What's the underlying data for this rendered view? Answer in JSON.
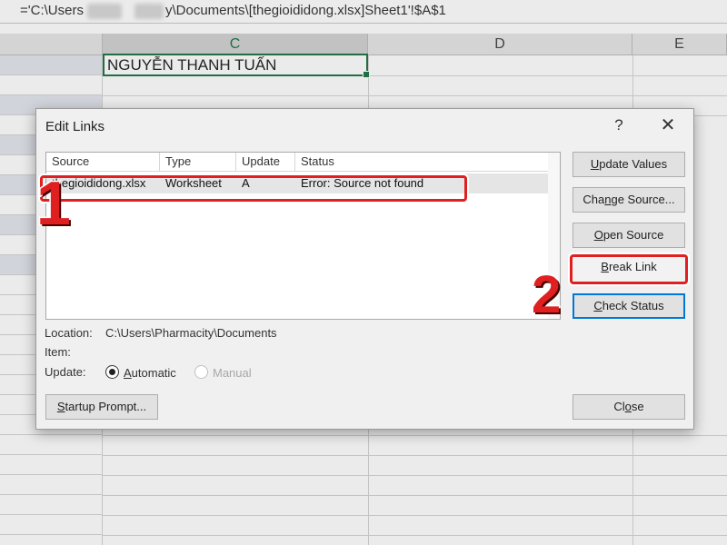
{
  "formula_bar": {
    "text_before": "='C:\\Users",
    "text_after": "y\\Documents\\[thegioididong.xlsx]Sheet1'!$A$1"
  },
  "grid": {
    "columns": [
      "C",
      "D",
      "E"
    ],
    "selected_column": "C",
    "cell_c1": "NGUYỄN THANH TUẤN"
  },
  "dialog": {
    "title": "Edit Links",
    "help": "?",
    "close": "✕",
    "table": {
      "headers": [
        "Source",
        "Type",
        "Update",
        "Status"
      ],
      "rows": [
        {
          "source": "thegioididong.xlsx",
          "type": "Worksheet",
          "update": "A",
          "status": "Error: Source not found"
        }
      ]
    },
    "buttons": {
      "update_values": {
        "u": "U",
        "rest": "pdate Values"
      },
      "change_source": {
        "pre": "Cha",
        "u": "n",
        "rest": "ge Source..."
      },
      "open_source": {
        "u": "O",
        "rest": "pen Source"
      },
      "break_link": {
        "u": "B",
        "rest": "reak Link"
      },
      "check_status": {
        "u": "C",
        "rest": "heck Status"
      },
      "startup_prompt": {
        "u": "S",
        "rest": "tartup Prompt..."
      },
      "close": {
        "pre": "Cl",
        "u": "o",
        "rest": "se"
      }
    },
    "location_label": "Location:",
    "location_value": "C:\\Users\\Pharmacity\\Documents",
    "item_label": "Item:",
    "update_label": "Update:",
    "update_options": {
      "automatic": {
        "u": "A",
        "rest": "utomatic",
        "selected": true
      },
      "manual": {
        "label": "Manual",
        "disabled": true
      }
    }
  },
  "annotations": {
    "step1": "1",
    "step2": "2",
    "color": "#e02020"
  }
}
